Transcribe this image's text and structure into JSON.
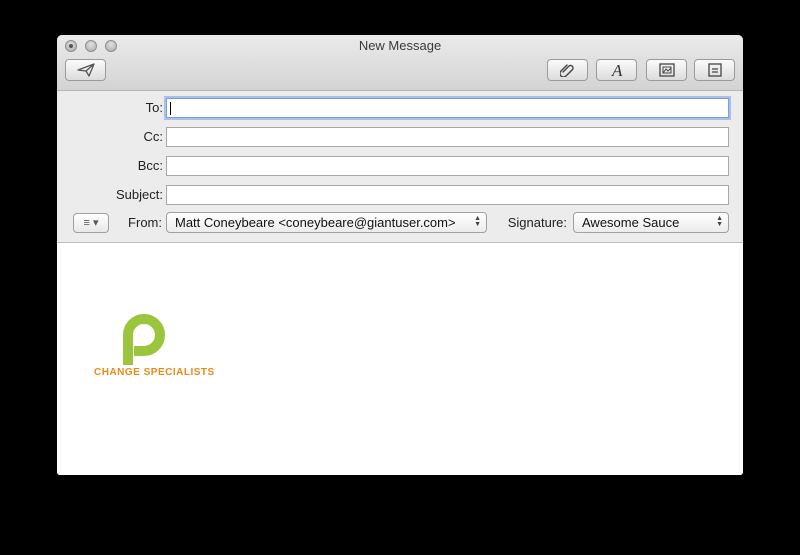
{
  "window": {
    "title": "New Message"
  },
  "toolbar": {
    "buttons": [
      {
        "name": "send",
        "icon": "paper-plane-icon"
      },
      {
        "name": "attach",
        "icon": "paperclip-icon"
      },
      {
        "name": "format",
        "icon": "font-icon"
      },
      {
        "name": "photo",
        "icon": "photo-browser-icon"
      },
      {
        "name": "template",
        "icon": "stationery-icon"
      }
    ]
  },
  "fields": {
    "to": {
      "label": "To:",
      "value": ""
    },
    "cc": {
      "label": "Cc:",
      "value": ""
    },
    "bcc": {
      "label": "Bcc:",
      "value": ""
    },
    "subject": {
      "label": "Subject:",
      "value": ""
    }
  },
  "from": {
    "label": "From:",
    "value": "Matt Coneybeare <coneybeare@giantuser.com>"
  },
  "signature": {
    "label": "Signature:",
    "value": "Awesome Sauce"
  },
  "body": {
    "logo_text": "CHANGE SPECIALISTS",
    "logo_color": "#9bc53d",
    "logo_text_color": "#e88a1a"
  }
}
